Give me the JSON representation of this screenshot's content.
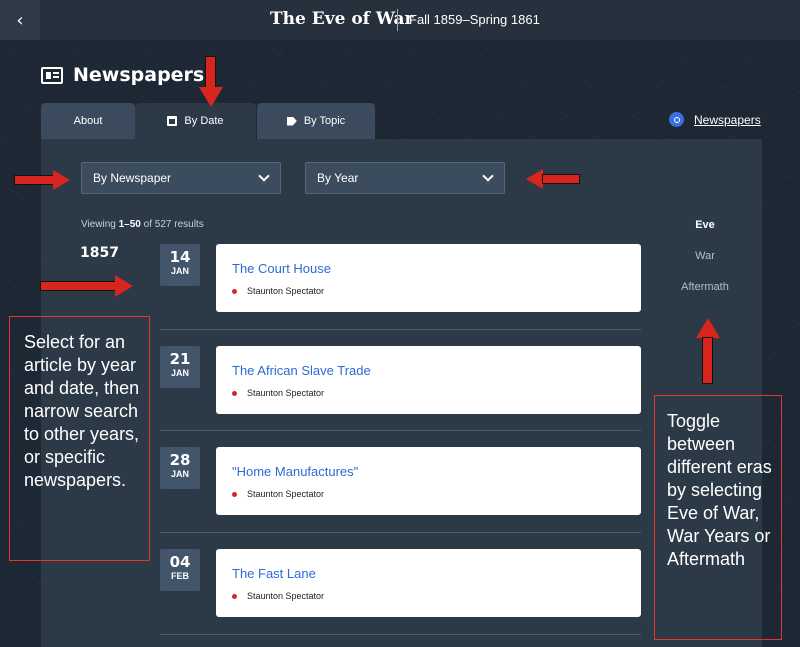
{
  "header": {
    "back_icon": "chevron-left-icon",
    "title": "The Eve of War",
    "subtitle": "Fall 1859–Spring 1861"
  },
  "page": {
    "heading": "Newspapers",
    "heading_icon": "newspaper-icon"
  },
  "tabs": [
    {
      "label": "About",
      "icon": "",
      "active": false
    },
    {
      "label": "By Date",
      "icon": "calendar-icon",
      "active": true
    },
    {
      "label": "By Topic",
      "icon": "tag-icon",
      "active": false
    }
  ],
  "search_link": {
    "label": "Newspapers",
    "icon": "search-icon"
  },
  "filters": {
    "newspaper": "By Newspaper",
    "year": "By Year"
  },
  "results": {
    "prefix": "Viewing ",
    "range": "1–50",
    "suffix": " of 527 results"
  },
  "year": "1857",
  "articles": [
    {
      "day": "14",
      "month": "JAN",
      "title": "The Court House",
      "source": "Staunton Spectator"
    },
    {
      "day": "21",
      "month": "JAN",
      "title": "The African Slave Trade",
      "source": "Staunton Spectator"
    },
    {
      "day": "28",
      "month": "JAN",
      "title": "\"Home Manufactures\"",
      "source": "Staunton Spectator"
    },
    {
      "day": "04",
      "month": "FEB",
      "title": "The Fast Lane",
      "source": "Staunton Spectator"
    }
  ],
  "eras": [
    {
      "label": "Eve",
      "active": true
    },
    {
      "label": "War",
      "active": false
    },
    {
      "label": "Aftermath",
      "active": false
    }
  ],
  "annotations": {
    "left": "Select for an article by year and date, then narrow search to other years, or specific newspapers.",
    "right": "Toggle between different eras by selecting Eve of War, War Years or Aftermath"
  },
  "colors": {
    "accent_link": "#2f6ad6",
    "annotation_red": "#d8251d",
    "source_dot": "#d4262b"
  }
}
